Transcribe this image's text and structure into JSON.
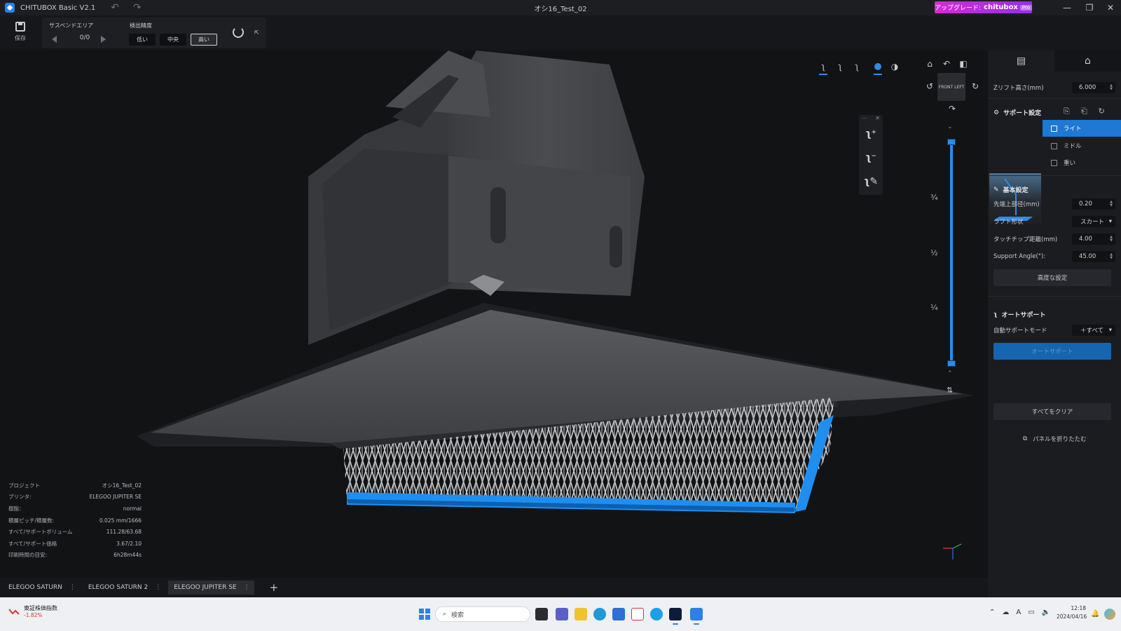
{
  "titlebar": {
    "app_name": "CHITUBOX Basic V2.1",
    "document": "オシ16_Test_02",
    "upgrade_label": "アップグレード:",
    "upgrade_brand": "chitubox",
    "upgrade_badge": "Pro",
    "minimize_glyph": "—",
    "maximize_glyph": "❐",
    "close_glyph": "✕"
  },
  "toolbar": {
    "save_label": "保存",
    "suspend_area_label": "サスペンドエリア",
    "suspend_count": "0/0",
    "precision_label": "検出精度",
    "precision_options": [
      "低い",
      "中央",
      "高い"
    ],
    "precision_selected": "高い"
  },
  "viewport": {
    "layer_fracs": [
      "¾",
      "½",
      "¼"
    ],
    "layer_top": 1.0,
    "layer_bottom": 0.0,
    "nav_cube_faces": [
      "FRONT",
      "LEFT"
    ]
  },
  "info": {
    "rows": [
      {
        "label": "プロジェクト",
        "value": "オシ16_Test_02"
      },
      {
        "label": "プリンタ:",
        "value": "ELEGOO JUPITER SE"
      },
      {
        "label": "樹脂：",
        "value": "normal"
      },
      {
        "label": "積層ピッチ/積層数:",
        "value": "0.025 mm/1666"
      },
      {
        "label": "すべて/サポートボリューム",
        "value": "111.28/63.68"
      },
      {
        "label": "すべて/サポート価格",
        "value": "3.67/2.10"
      },
      {
        "label": "印刷時間の目安:",
        "value": "6h28m44s"
      }
    ]
  },
  "printer_tabs": [
    "ELEGOO SATURN",
    "ELEGOO SATURN 2",
    "ELEGOO JUPITER SE"
  ],
  "printer_tab_active": "ELEGOO JUPITER SE",
  "right_panel": {
    "z_lift_label": "Zリフト高さ(mm)",
    "z_lift_value": "6.000",
    "support_settings_title": "サポート設定",
    "presets": [
      "ライト",
      "ミドル",
      "重い"
    ],
    "preset_selected": "ライト",
    "basic_settings_title": "基本設定",
    "fields": [
      {
        "label": "先端上部径(mm)",
        "value": "0.20",
        "kind": "number"
      },
      {
        "label": "ラフト形状",
        "value": "スカート",
        "kind": "select"
      },
      {
        "label": "タッチチップ距離(mm)",
        "value": "4.00",
        "kind": "number"
      },
      {
        "label": "Support Angle(°):",
        "value": "45.00",
        "kind": "number"
      }
    ],
    "advanced_label": "高度な設定",
    "auto_support_title": "オートサポート",
    "auto_mode_label": "自動サポートモード",
    "auto_mode_value": "＋すべて",
    "auto_support_button": "オートサポート",
    "collapse_label": "パネルを折りたたむ",
    "clear_all_label": "すべてをクリア"
  },
  "taskbar": {
    "stock_title": "東証株価指数",
    "stock_change": "-1.82%",
    "search_placeholder": "検索",
    "time": "12:18",
    "date": "2024/04/16"
  },
  "colors": {
    "accent": "#2e8be8",
    "support_blue": "#1e8ff0",
    "panel_bg": "#1b1c20",
    "upgrade_from": "#d02dd0",
    "upgrade_to": "#9b2cf0"
  }
}
